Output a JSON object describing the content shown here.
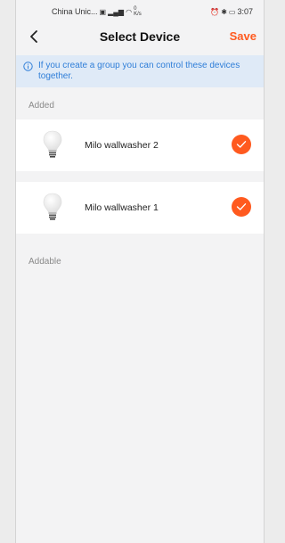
{
  "status_bar": {
    "carrier": "China Unic...",
    "network_speed": "0",
    "network_unit": "K/s",
    "time": "3:07"
  },
  "header": {
    "title": "Select Device",
    "save_label": "Save"
  },
  "info_banner": {
    "text": "If you create a group you can control these devices together."
  },
  "sections": {
    "added_label": "Added",
    "addable_label": "Addable"
  },
  "devices": [
    {
      "name": "Milo wallwasher 2",
      "selected": true
    },
    {
      "name": "Milo wallwasher 1",
      "selected": true
    }
  ],
  "colors": {
    "accent": "#ff5a1f",
    "info_text": "#2f7ed8",
    "info_bg": "#dfeaf7",
    "background": "#f3f3f4"
  }
}
